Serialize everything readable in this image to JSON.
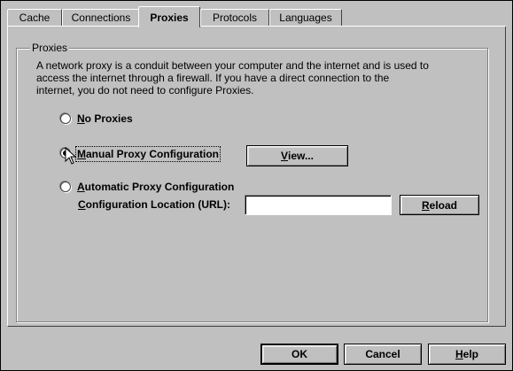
{
  "tabs": [
    {
      "label": "Cache",
      "active": false
    },
    {
      "label": "Connections",
      "active": false
    },
    {
      "label": "Proxies",
      "active": true
    },
    {
      "label": "Protocols",
      "active": false
    },
    {
      "label": "Languages",
      "active": false
    }
  ],
  "group": {
    "title": "Proxies",
    "description_lines": [
      "A network proxy is a conduit between your computer and the internet and is used to",
      "access the internet through a firewall.  If you have a direct connection to the",
      "internet, you do not need to configure Proxies."
    ]
  },
  "options": {
    "no_proxies": {
      "prefix": "",
      "mnemonic": "N",
      "rest": "o Proxies",
      "selected": false
    },
    "manual": {
      "prefix": "",
      "mnemonic": "M",
      "rest": "anual Proxy Configuration",
      "selected": true
    },
    "automatic": {
      "prefix": "",
      "mnemonic": "A",
      "rest": "utomatic Proxy Configuration",
      "selected": false
    }
  },
  "view_button": {
    "mnemonic": "V",
    "rest": "iew..."
  },
  "config_location": {
    "mnemonic": "C",
    "rest": "onfiguration Location (URL):",
    "value": ""
  },
  "reload_button": {
    "mnemonic": "R",
    "rest": "eload"
  },
  "footer": {
    "ok_label": "OK",
    "cancel_label": "Cancel",
    "help_mnemonic": "H",
    "help_rest": "elp"
  },
  "cursor_icon": "arrow-pointer-icon"
}
